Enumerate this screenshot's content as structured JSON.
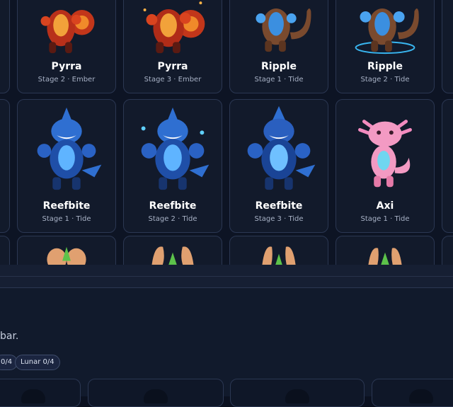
{
  "cards": [
    {
      "name": "Pyrra",
      "sub": "Stage 2 · Ember"
    },
    {
      "name": "Pyrra",
      "sub": "Stage 3 · Ember"
    },
    {
      "name": "Ripple",
      "sub": "Stage 1 · Tide"
    },
    {
      "name": "Ripple",
      "sub": "Stage 2 · Tide"
    },
    {
      "name": "Reefbite",
      "sub": "Stage 1 · Tide"
    },
    {
      "name": "Reefbite",
      "sub": "Stage 2 · Tide"
    },
    {
      "name": "Reefbite",
      "sub": "Stage 3 · Tide"
    },
    {
      "name": "Axi",
      "sub": "Stage 1 · Tide"
    }
  ],
  "panel": {
    "text_fragment": "bar.",
    "chips": [
      "0/4",
      "Lunar 0/4"
    ]
  },
  "colors": {
    "ember": "#e0471f",
    "tide_blue": "#2f6fd1",
    "otter_brown": "#7a4a2e",
    "axi_pink": "#f39ac3"
  }
}
